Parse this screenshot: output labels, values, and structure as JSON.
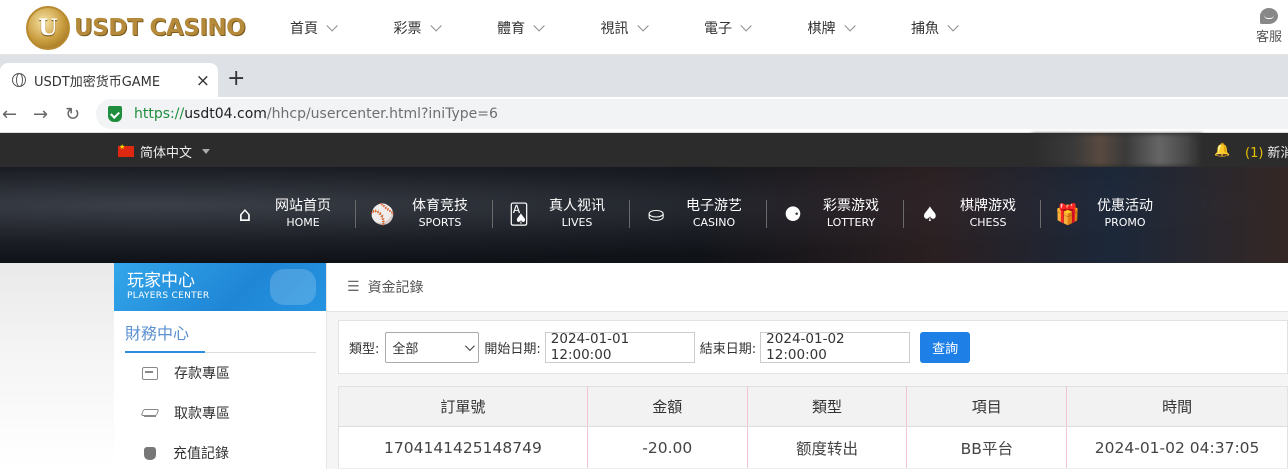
{
  "site": {
    "logo_text": "USDT CASINO",
    "logo_badge": "U",
    "nav": [
      {
        "label": "首頁"
      },
      {
        "label": "彩票"
      },
      {
        "label": "體育"
      },
      {
        "label": "視訊"
      },
      {
        "label": "電子"
      },
      {
        "label": "棋牌"
      },
      {
        "label": "捕魚"
      }
    ],
    "service_label": "客服"
  },
  "browser": {
    "tab_title": "USDT加密货币GAME",
    "tab_close": "×",
    "new_tab": "+",
    "url_scheme": "https://",
    "url_host": "usdt04.com",
    "url_path": "/hhcp/usercenter.html?iniType=6",
    "back": "←",
    "forward": "→",
    "reload": "↻"
  },
  "strip": {
    "language": "简体中文",
    "notify_count": "(1)",
    "notify_text": "新消"
  },
  "categories": [
    {
      "icon": "home-icon",
      "glyph": "⌂",
      "cn": "网站首页",
      "en": "HOME"
    },
    {
      "icon": "basketball-icon",
      "glyph": "⚾",
      "cn": "体育竞技",
      "en": "SPORTS"
    },
    {
      "icon": "cards-icon",
      "glyph": "🂡",
      "cn": "真人视讯",
      "en": "LIVES"
    },
    {
      "icon": "casino-chip-icon",
      "glyph": "⛀",
      "cn": "电子游艺",
      "en": "CASINO"
    },
    {
      "icon": "lottery-balls-icon",
      "glyph": "⚈",
      "cn": "彩票游戏",
      "en": "LOTTERY"
    },
    {
      "icon": "spade-icon",
      "glyph": "♠",
      "cn": "棋牌游戏",
      "en": "CHESS"
    },
    {
      "icon": "gift-icon",
      "glyph": "🎁",
      "cn": "优惠活动",
      "en": "PROMO"
    }
  ],
  "sidebar": {
    "title": "玩家中心",
    "subtitle": "PLAYERS CENTER",
    "section": "財務中心",
    "items": [
      {
        "label": "存款專區"
      },
      {
        "label": "取款專區"
      },
      {
        "label": "充值記錄"
      }
    ]
  },
  "main": {
    "breadcrumb": "資金記錄",
    "filter": {
      "type_label": "類型:",
      "type_value": "全部",
      "start_label": "開始日期:",
      "start_value": "2024-01-01 12:00:00",
      "end_label": "結束日期:",
      "end_value": "2024-01-02 12:00:00",
      "query_button": "查詢"
    },
    "table": {
      "headers": [
        "訂單號",
        "金額",
        "類型",
        "項目",
        "時間"
      ],
      "rows": [
        [
          "1704141425148749",
          "-20.00",
          "额度转出",
          "BB平台",
          "2024-01-02 04:37:05"
        ]
      ]
    }
  }
}
